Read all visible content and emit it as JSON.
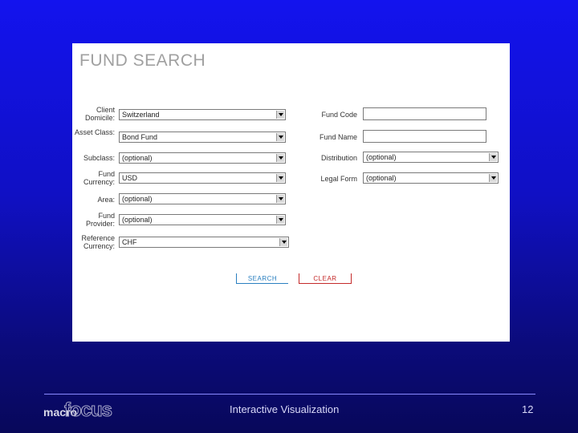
{
  "panel": {
    "title": "FUND SEARCH"
  },
  "left_fields": [
    {
      "label": "Client Domicile:",
      "value": "Switzerland"
    },
    {
      "label": "Asset Class:",
      "value": "Bond Fund"
    },
    {
      "label": "Subclass:",
      "value": "(optional)"
    },
    {
      "label": "Fund Currency:",
      "value": "USD"
    },
    {
      "label": "Area:",
      "value": "(optional)"
    },
    {
      "label": "Fund Provider:",
      "value": "(optional)"
    },
    {
      "label": "Reference Currency:",
      "value": "CHF"
    }
  ],
  "right_fields": [
    {
      "label": "Fund Code",
      "value": ""
    },
    {
      "label": "Fund Name",
      "value": ""
    },
    {
      "label": "Distribution",
      "value": "(optional)"
    },
    {
      "label": "Legal Form",
      "value": "(optional)"
    }
  ],
  "buttons": {
    "search": "SEARCH",
    "clear": "CLEAR"
  },
  "footer": {
    "logo_prefix": "macro",
    "logo_main": "focus",
    "center_text": "Interactive Visualization",
    "page_number": "12"
  }
}
